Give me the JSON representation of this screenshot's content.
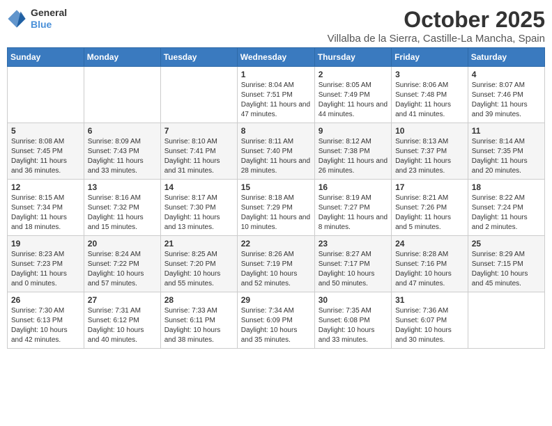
{
  "header": {
    "logo_line1": "General",
    "logo_line2": "Blue",
    "month": "October 2025",
    "location": "Villalba de la Sierra, Castille-La Mancha, Spain"
  },
  "weekdays": [
    "Sunday",
    "Monday",
    "Tuesday",
    "Wednesday",
    "Thursday",
    "Friday",
    "Saturday"
  ],
  "weeks": [
    [
      {
        "day": "",
        "info": ""
      },
      {
        "day": "",
        "info": ""
      },
      {
        "day": "",
        "info": ""
      },
      {
        "day": "1",
        "info": "Sunrise: 8:04 AM\nSunset: 7:51 PM\nDaylight: 11 hours and 47 minutes."
      },
      {
        "day": "2",
        "info": "Sunrise: 8:05 AM\nSunset: 7:49 PM\nDaylight: 11 hours and 44 minutes."
      },
      {
        "day": "3",
        "info": "Sunrise: 8:06 AM\nSunset: 7:48 PM\nDaylight: 11 hours and 41 minutes."
      },
      {
        "day": "4",
        "info": "Sunrise: 8:07 AM\nSunset: 7:46 PM\nDaylight: 11 hours and 39 minutes."
      }
    ],
    [
      {
        "day": "5",
        "info": "Sunrise: 8:08 AM\nSunset: 7:45 PM\nDaylight: 11 hours and 36 minutes."
      },
      {
        "day": "6",
        "info": "Sunrise: 8:09 AM\nSunset: 7:43 PM\nDaylight: 11 hours and 33 minutes."
      },
      {
        "day": "7",
        "info": "Sunrise: 8:10 AM\nSunset: 7:41 PM\nDaylight: 11 hours and 31 minutes."
      },
      {
        "day": "8",
        "info": "Sunrise: 8:11 AM\nSunset: 7:40 PM\nDaylight: 11 hours and 28 minutes."
      },
      {
        "day": "9",
        "info": "Sunrise: 8:12 AM\nSunset: 7:38 PM\nDaylight: 11 hours and 26 minutes."
      },
      {
        "day": "10",
        "info": "Sunrise: 8:13 AM\nSunset: 7:37 PM\nDaylight: 11 hours and 23 minutes."
      },
      {
        "day": "11",
        "info": "Sunrise: 8:14 AM\nSunset: 7:35 PM\nDaylight: 11 hours and 20 minutes."
      }
    ],
    [
      {
        "day": "12",
        "info": "Sunrise: 8:15 AM\nSunset: 7:34 PM\nDaylight: 11 hours and 18 minutes."
      },
      {
        "day": "13",
        "info": "Sunrise: 8:16 AM\nSunset: 7:32 PM\nDaylight: 11 hours and 15 minutes."
      },
      {
        "day": "14",
        "info": "Sunrise: 8:17 AM\nSunset: 7:30 PM\nDaylight: 11 hours and 13 minutes."
      },
      {
        "day": "15",
        "info": "Sunrise: 8:18 AM\nSunset: 7:29 PM\nDaylight: 11 hours and 10 minutes."
      },
      {
        "day": "16",
        "info": "Sunrise: 8:19 AM\nSunset: 7:27 PM\nDaylight: 11 hours and 8 minutes."
      },
      {
        "day": "17",
        "info": "Sunrise: 8:21 AM\nSunset: 7:26 PM\nDaylight: 11 hours and 5 minutes."
      },
      {
        "day": "18",
        "info": "Sunrise: 8:22 AM\nSunset: 7:24 PM\nDaylight: 11 hours and 2 minutes."
      }
    ],
    [
      {
        "day": "19",
        "info": "Sunrise: 8:23 AM\nSunset: 7:23 PM\nDaylight: 11 hours and 0 minutes."
      },
      {
        "day": "20",
        "info": "Sunrise: 8:24 AM\nSunset: 7:22 PM\nDaylight: 10 hours and 57 minutes."
      },
      {
        "day": "21",
        "info": "Sunrise: 8:25 AM\nSunset: 7:20 PM\nDaylight: 10 hours and 55 minutes."
      },
      {
        "day": "22",
        "info": "Sunrise: 8:26 AM\nSunset: 7:19 PM\nDaylight: 10 hours and 52 minutes."
      },
      {
        "day": "23",
        "info": "Sunrise: 8:27 AM\nSunset: 7:17 PM\nDaylight: 10 hours and 50 minutes."
      },
      {
        "day": "24",
        "info": "Sunrise: 8:28 AM\nSunset: 7:16 PM\nDaylight: 10 hours and 47 minutes."
      },
      {
        "day": "25",
        "info": "Sunrise: 8:29 AM\nSunset: 7:15 PM\nDaylight: 10 hours and 45 minutes."
      }
    ],
    [
      {
        "day": "26",
        "info": "Sunrise: 7:30 AM\nSunset: 6:13 PM\nDaylight: 10 hours and 42 minutes."
      },
      {
        "day": "27",
        "info": "Sunrise: 7:31 AM\nSunset: 6:12 PM\nDaylight: 10 hours and 40 minutes."
      },
      {
        "day": "28",
        "info": "Sunrise: 7:33 AM\nSunset: 6:11 PM\nDaylight: 10 hours and 38 minutes."
      },
      {
        "day": "29",
        "info": "Sunrise: 7:34 AM\nSunset: 6:09 PM\nDaylight: 10 hours and 35 minutes."
      },
      {
        "day": "30",
        "info": "Sunrise: 7:35 AM\nSunset: 6:08 PM\nDaylight: 10 hours and 33 minutes."
      },
      {
        "day": "31",
        "info": "Sunrise: 7:36 AM\nSunset: 6:07 PM\nDaylight: 10 hours and 30 minutes."
      },
      {
        "day": "",
        "info": ""
      }
    ]
  ]
}
